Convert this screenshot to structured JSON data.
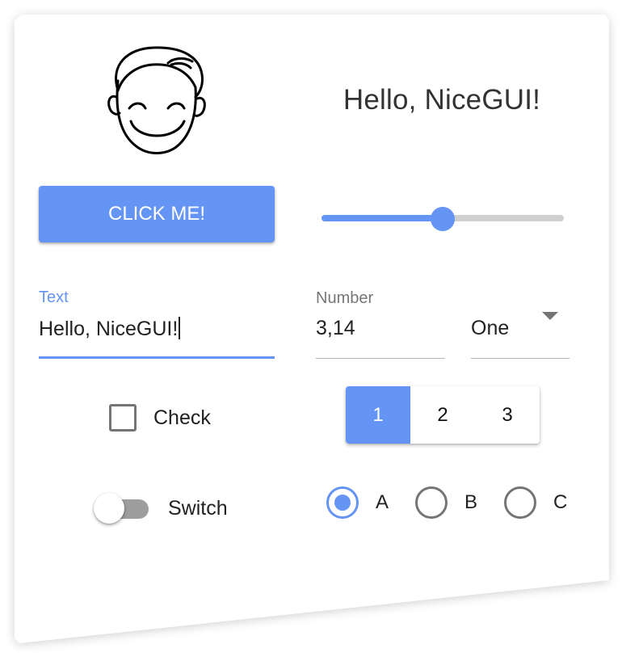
{
  "app": {
    "greeting": "Hello, NiceGUI!",
    "avatar_icon": "smiling-face-icon"
  },
  "controls": {
    "button_label": "CLICK ME!",
    "slider": {
      "value": 0.5,
      "min": 0,
      "max": 1
    },
    "text_input": {
      "label": "Text",
      "value": "Hello, NiceGUI!"
    },
    "number_input": {
      "label": "Number",
      "value": "3,14"
    },
    "select": {
      "selected": "One"
    },
    "checkbox": {
      "label": "Check",
      "checked": false
    },
    "toggle": {
      "options": [
        "1",
        "2",
        "3"
      ],
      "selected": "1"
    },
    "switch": {
      "label": "Switch",
      "on": false
    },
    "radio": {
      "options": [
        "A",
        "B",
        "C"
      ],
      "selected": "A"
    }
  },
  "colors": {
    "accent": "#6494f4",
    "inactive": "#757575",
    "track": "#cfcfcf"
  }
}
